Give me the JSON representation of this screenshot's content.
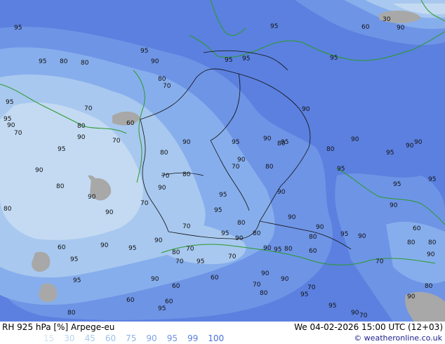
{
  "title": "RH 925 hPa [%] Arpege-eu",
  "valid_time": "We 04-02-2026 15:00 UTC (12+03)",
  "credit": "© weatheronline.co.uk",
  "legend": {
    "values": [
      "15",
      "30",
      "45",
      "60",
      "75",
      "90",
      "95",
      "99",
      "100"
    ],
    "colors": [
      "#cfe3f3",
      "#b8d6ef",
      "#a8cbec",
      "#9cc0ea",
      "#8fb2e8",
      "#7fa2e6",
      "#6f90e2",
      "#5b7fde",
      "#4b6ed8"
    ]
  },
  "colors": {
    "rh_very_humid": "#4f74dd",
    "rh_humid": "#6d93e6",
    "rh_moist": "#86acec",
    "rh_mid": "#a7c7ef",
    "rh_dry": "#c4dbf2",
    "rh_very_dry": "#a9a9a9",
    "coast": "#2a9a2a",
    "border": "#111111"
  },
  "contour_labels": [
    "95",
    "95",
    "95",
    "90",
    "80",
    "80",
    "95",
    "95",
    "95",
    "95",
    "90",
    "60",
    "30",
    "90",
    "95",
    "95",
    "95",
    "90",
    "70",
    "80",
    "70",
    "60",
    "90",
    "70",
    "80",
    "90",
    "70",
    "80",
    "95",
    "90",
    "95",
    "90",
    "80",
    "80",
    "70",
    "80",
    "70",
    "90",
    "80",
    "90",
    "95",
    "90",
    "90",
    "95",
    "95",
    "80",
    "90",
    "90",
    "95",
    "95",
    "90",
    "90",
    "70",
    "80",
    "90",
    "70",
    "95",
    "80",
    "90",
    "90",
    "95",
    "80",
    "90",
    "80",
    "95",
    "90",
    "60",
    "80",
    "70",
    "80",
    "60",
    "90",
    "95",
    "80",
    "90",
    "90",
    "95",
    "95",
    "70",
    "90",
    "95",
    "80",
    "60",
    "70",
    "60",
    "90",
    "90",
    "95",
    "70",
    "60",
    "70",
    "90",
    "80",
    "60",
    "60",
    "70",
    "95",
    "95",
    "95",
    "90",
    "80",
    "80",
    "90",
    "70",
    "90",
    "95",
    "80",
    "90",
    "95",
    "60"
  ]
}
